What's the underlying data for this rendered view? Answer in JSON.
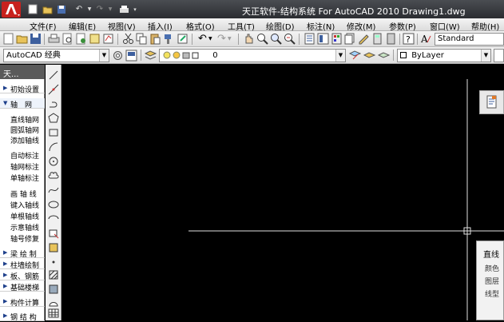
{
  "titlebar": {
    "title": "天正软件-结构系统 For AutoCAD 2010     Drawing1.dwg"
  },
  "menu": [
    "文件(F)",
    "编辑(E)",
    "视图(V)",
    "插入(I)",
    "格式(O)",
    "工具(T)",
    "绘图(D)",
    "标注(N)",
    "修改(M)",
    "参数(P)",
    "窗口(W)",
    "帮助(H)"
  ],
  "toolbar": {
    "text_style": "Standard",
    "workspace": "AutoCAD 经典",
    "layer": "0",
    "color": "ByLayer"
  },
  "sidebar": {
    "header": "天...",
    "items": [
      {
        "label": "初始设置",
        "type": "cat"
      },
      {
        "label": "轴　网",
        "type": "cat"
      },
      {
        "label": "直线轴网",
        "type": "sub"
      },
      {
        "label": "圆弧轴网",
        "type": "sub"
      },
      {
        "label": "添加轴线",
        "type": "sub"
      },
      {
        "label": "自动标注",
        "type": "sub"
      },
      {
        "label": "轴网标注",
        "type": "sub"
      },
      {
        "label": "单轴标注",
        "type": "sub"
      },
      {
        "label": "画 轴 线",
        "type": "sub"
      },
      {
        "label": "键入轴线",
        "type": "sub"
      },
      {
        "label": "单根轴线",
        "type": "sub"
      },
      {
        "label": "示意轴线",
        "type": "sub"
      },
      {
        "label": "轴号修复",
        "type": "sub"
      },
      {
        "label": "梁 绘 制",
        "type": "cat"
      },
      {
        "label": "柱墙绘制",
        "type": "cat"
      },
      {
        "label": "板、钢筋",
        "type": "cat"
      },
      {
        "label": "基础楼梯",
        "type": "cat"
      },
      {
        "label": "构件计算",
        "type": "cat"
      },
      {
        "label": "钢 结 构",
        "type": "cat"
      }
    ]
  },
  "properties": {
    "title": "直线",
    "items": [
      "颜色",
      "图层",
      "线型"
    ]
  },
  "colors": {
    "canvas_bg": "#000000",
    "crosshair": "#e0e0e0",
    "logo_red": "#c8221e"
  }
}
